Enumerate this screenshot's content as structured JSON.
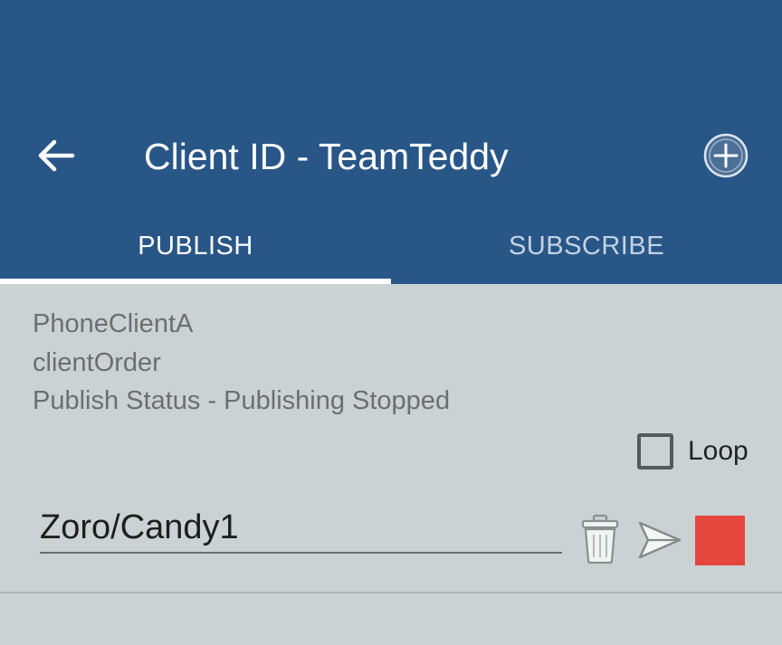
{
  "header": {
    "title": "Client ID - TeamTeddy",
    "back_icon": "arrow-left-icon",
    "add_icon": "plus-circle-icon"
  },
  "tabs": [
    {
      "label": "PUBLISH",
      "selected": true
    },
    {
      "label": "SUBSCRIBE",
      "selected": false
    }
  ],
  "publish": {
    "client_name": "PhoneClientA",
    "topic_name": "clientOrder",
    "status": "Publish Status - Publishing Stopped",
    "loop": {
      "label": "Loop",
      "checked": false
    },
    "message": {
      "value": "Zoro/Candy1"
    },
    "actions": {
      "delete_icon": "trash-icon",
      "send_icon": "send-icon",
      "stop_icon": "stop-square-icon"
    }
  },
  "colors": {
    "app_bar": "#285687",
    "background": "#cbd2d3",
    "stop": "#e4453c",
    "tab_inactive": "#c4d2e4"
  }
}
